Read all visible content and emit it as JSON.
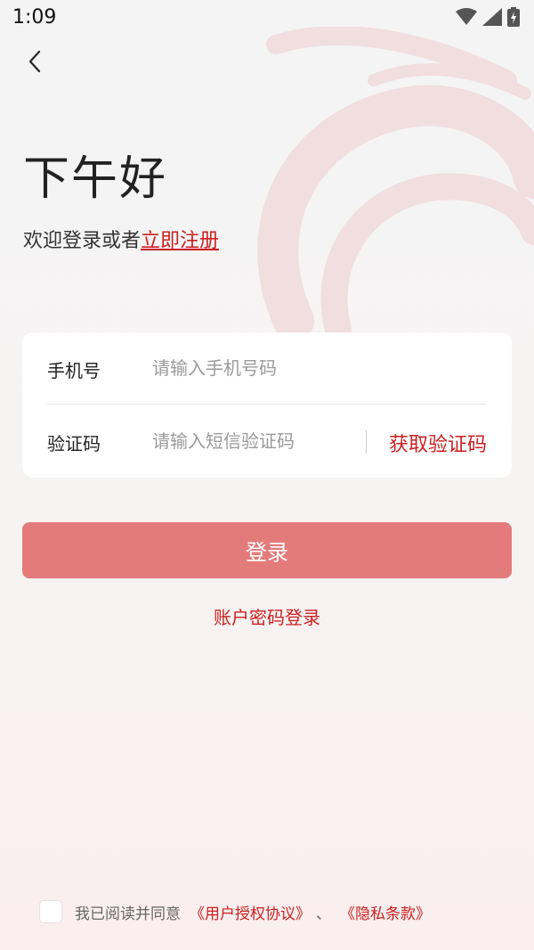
{
  "status_bar": {
    "time": "1:09"
  },
  "header": {
    "greeting": "下午好",
    "subtitle_prefix": "欢迎登录或者",
    "register_link": "立即注册"
  },
  "form": {
    "phone": {
      "label": "手机号",
      "placeholder": "请输入手机号码",
      "value": ""
    },
    "code": {
      "label": "验证码",
      "placeholder": "请输入短信验证码",
      "value": "",
      "get_code_label": "获取验证码"
    }
  },
  "actions": {
    "login_label": "登录",
    "password_login_label": "账户密码登录"
  },
  "agreement": {
    "checked": false,
    "text": "我已阅读并同意",
    "user_agreement": "《用户授权协议》",
    "separator": "、",
    "privacy_policy": "《隐私条款》"
  },
  "theme": {
    "accent": "#cc1f1f",
    "button": "#e47b7b",
    "background": "#f4f4f4"
  },
  "icons": {
    "back": "chevron-left-icon",
    "wifi": "wifi-icon",
    "signal": "signal-icon",
    "battery": "battery-charging-icon"
  }
}
